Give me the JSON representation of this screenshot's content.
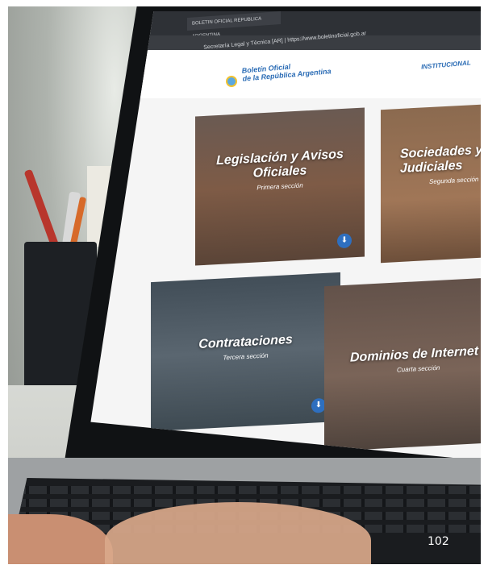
{
  "browser": {
    "tab_label": "BOLETIN OFICIAL REPUBLICA ARGENTINA",
    "url": "Secretaría Legal y Técnica [AR] | https://www.boletinoficial.gob.ar"
  },
  "site": {
    "brand_line1": "Boletín Oficial",
    "brand_line2": "de la República Argentina",
    "nav_item": "INSTITUCIONAL"
  },
  "cards": [
    {
      "title": "Legislación y Avisos Oficiales",
      "subtitle": "Primera sección"
    },
    {
      "title": "Sociedades y Judiciales",
      "subtitle": "Segunda sección"
    },
    {
      "title": "Contrataciones",
      "subtitle": "Tercera sección"
    },
    {
      "title": "Dominios de Internet",
      "subtitle": "Cuarta sección"
    }
  ],
  "page_number": "102"
}
